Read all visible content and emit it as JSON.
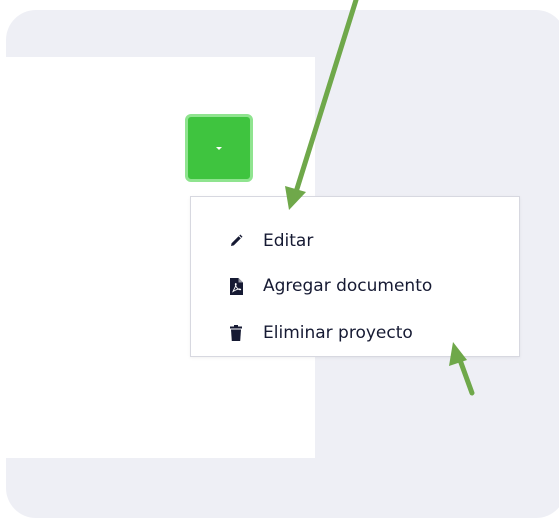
{
  "colors": {
    "background": "#eeeff5",
    "panel": "#ffffff",
    "accent_green": "#3fc43f",
    "button_border": "#8fe48f",
    "annotation_arrow": "#6fa84a",
    "menu_text": "#161a33"
  },
  "toggle": {
    "icon": "caret-down-icon"
  },
  "menu": {
    "items": [
      {
        "label": "Editar",
        "icon": "pencil-icon"
      },
      {
        "label": "Agregar documento",
        "icon": "pdf-file-icon"
      },
      {
        "label": "Eliminar proyecto",
        "icon": "trash-icon"
      }
    ]
  },
  "annotations": [
    {
      "icon": "arrow-pointer",
      "target": "Editar"
    },
    {
      "icon": "arrow-pointer",
      "target": "Eliminar proyecto"
    }
  ]
}
